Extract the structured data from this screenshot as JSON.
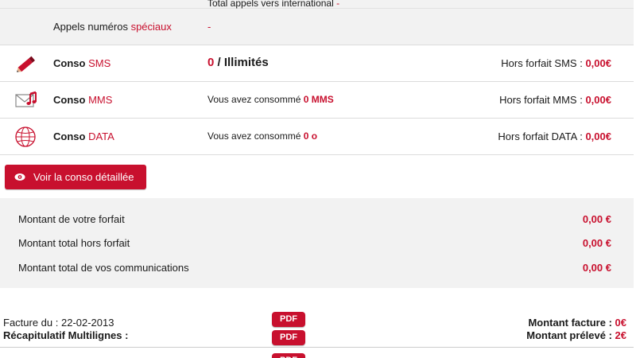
{
  "top": {
    "international_label": "Total appels vers international",
    "international_value": "-",
    "special_label_prefix": "Appels numéros",
    "special_label_highlight": "spéciaux",
    "special_value": "-"
  },
  "rows": {
    "sms": {
      "label_prefix": "Conso",
      "label_highlight": "SMS",
      "count": "0",
      "count_suffix": " / Illimités",
      "extra_label": "Hors forfait SMS :",
      "extra_value": "0,00€",
      "icon": "pencil-icon"
    },
    "mms": {
      "label_prefix": "Conso",
      "label_highlight": "MMS",
      "usage_prefix": "Vous avez consommé",
      "usage_value": "0 MMS",
      "extra_label": "Hors forfait MMS :",
      "extra_value": "0,00€",
      "icon": "envelope-music-icon"
    },
    "data": {
      "label_prefix": "Conso",
      "label_highlight": "DATA",
      "usage_prefix": "Vous avez consommé",
      "usage_value": "0 o",
      "extra_label": "Hors forfait DATA :",
      "extra_value": "0,00€",
      "icon": "globe-icon"
    }
  },
  "detail_button": {
    "label": "Voir la conso détaillée",
    "icon": "eye-icon"
  },
  "summary": {
    "forfait_label": "Montant de votre forfait",
    "forfait_value": "0,00 €",
    "hors_forfait_label": "Montant total hors forfait",
    "hors_forfait_value": "0,00 €",
    "communications_label": "Montant total de vos communications",
    "communications_value": "0,00 €"
  },
  "invoice": {
    "date_label": "Facture du : 22-02-2013",
    "recap_label": "Récapitulatif Multilignes :",
    "pdf_label": "PDF",
    "amount_label": "Montant facture :",
    "amount_value": "0€",
    "debited_label": "Montant prélevé :",
    "debited_value": "2€"
  },
  "colors": {
    "accent": "#c8102e",
    "band": "#f2f2f2"
  }
}
